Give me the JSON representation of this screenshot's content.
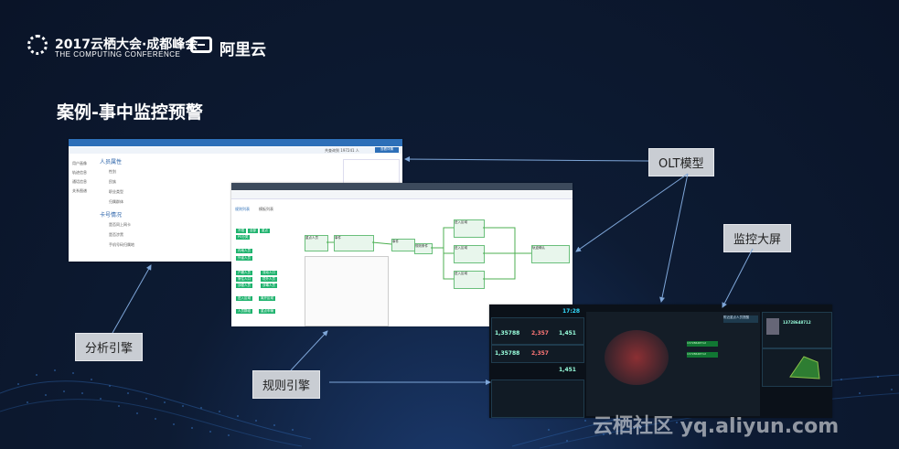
{
  "header": {
    "conference_cn": "2017云栖大会·成都峰会",
    "conference_en": "THE COMPUTING CONFERENCE",
    "brand": "阿里云"
  },
  "slide_title": "案例-事中监控预警",
  "callouts": {
    "olt": "OLT模型",
    "screen": "监控大屏",
    "analysis": "分析引擎",
    "rules": "规则引擎"
  },
  "analysis_ui": {
    "section_person": "人员属性",
    "section_card": "卡号情况",
    "count_label": "共查询到 197241 人",
    "action_btn": "查看详情",
    "fields": [
      "性别",
      "民族",
      "职业类型",
      "归属群体",
      "是否同上网卡",
      "是否涉黑",
      "手机号码归属地"
    ],
    "side_items": [
      "用户画像",
      "轨迹信息",
      "通话信息",
      "关系图谱"
    ]
  },
  "rules_ui": {
    "tabs": [
      "规则列表",
      "模板列表"
    ],
    "node_labels": [
      "重点人员",
      "事件",
      "事件",
      "规则条件",
      "进入区域",
      "进入区域",
      "进入区域",
      "轨迹确认"
    ],
    "chips": [
      "不限",
      "全部",
      "重点",
      "PS分类",
      "内地人员",
      "外省人员",
      "户籍人员",
      "流动人口",
      "常住人口",
      "境外人员",
      "涉稳人员",
      "涉毒人员",
      "进入区域",
      "离开区域",
      "人员群组",
      "重点车辆"
    ]
  },
  "dashboard": {
    "time": "17:28",
    "kpis": [
      "1,35788",
      "2,357",
      "1,451",
      "1,35788",
      "2,357",
      "1,451"
    ],
    "person_id": "13728648712",
    "alert_title": "附近重点人员提醒"
  },
  "watermark": "云栖社区 yq.aliyun.com"
}
